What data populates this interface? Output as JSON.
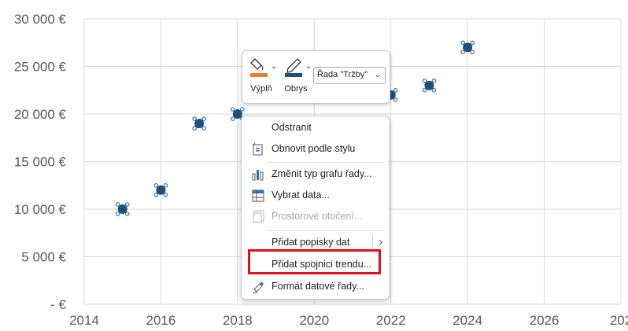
{
  "chart_data": {
    "type": "scatter",
    "x": [
      2015,
      2016,
      2017,
      2018,
      2022,
      2023,
      2024
    ],
    "y": [
      10000,
      12000,
      19000,
      20000,
      22000,
      23000,
      27000
    ],
    "xlim": [
      2014,
      2028
    ],
    "ylim": [
      0,
      30000
    ],
    "x_ticks": [
      "2014",
      "2016",
      "2018",
      "2020",
      "2022",
      "2024",
      "2026",
      "202"
    ],
    "y_ticks": [
      "30 000 €",
      "25 000 €",
      "20 000 €",
      "15 000 €",
      "10 000 €",
      "5 000 €",
      "-  €"
    ],
    "grid": true,
    "marker_color": "#1f4e79",
    "grid_color": "#d9d9d9"
  },
  "mini_toolbar": {
    "fill_label": "Výplň",
    "outline_label": "Obrys",
    "series_selected": "Řada \"Tržby\"",
    "fill_color": "#ed7d31",
    "outline_color": "#1f4e79"
  },
  "context_menu": {
    "items": [
      {
        "label": "Odstranit",
        "icon": "none"
      },
      {
        "label": "Obnovit podle stylu",
        "icon": "reset-style-icon"
      },
      {
        "label": "Změnit typ grafu řady...",
        "icon": "chart-type-icon"
      },
      {
        "label": "Vybrat data...",
        "icon": "select-data-icon"
      },
      {
        "label": "Prostorové otočení...",
        "icon": "3d-rotation-icon",
        "disabled": true
      },
      {
        "label": "Přidat popisky dat",
        "icon": "none",
        "submenu": true
      },
      {
        "label": "Přidat spojnici trendu...",
        "icon": "none"
      },
      {
        "label": "Formát datové řady...",
        "icon": "format-series-icon"
      }
    ],
    "highlight_color": "#e0101e"
  }
}
